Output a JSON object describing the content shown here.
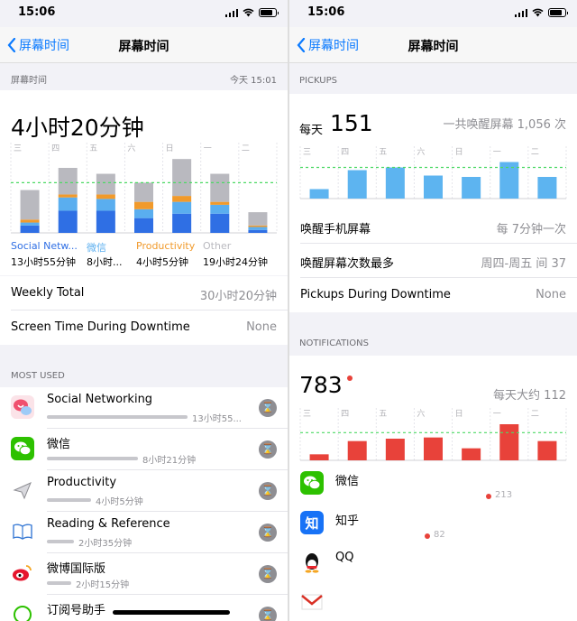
{
  "status": {
    "time": "15:06"
  },
  "nav": {
    "back_label": "屏幕时间",
    "title": "屏幕时间"
  },
  "left": {
    "section_label": "屏幕时间",
    "section_time": "今天 15:01",
    "total": "4小时20分钟",
    "day_labels": [
      "三",
      "四",
      "五",
      "六",
      "日",
      "一",
      "二"
    ],
    "legend": [
      {
        "name": "Social Netw...",
        "color": "#2f6fe4",
        "value": "13小时55分钟"
      },
      {
        "name": "微信",
        "color": "#5aaeef",
        "value": "8小时..."
      },
      {
        "name": "Productivity",
        "color": "#f19a2b",
        "value": "4小时5分钟"
      },
      {
        "name": "Other",
        "color": "#b9b9bf",
        "value": "19小时24分钟"
      }
    ],
    "weekly_total_label": "Weekly Total",
    "weekly_total_value": "30小时20分钟",
    "downtime_label": "Screen Time During Downtime",
    "downtime_value": "None",
    "most_used_label": "MOST USED",
    "apps": [
      {
        "name": "Social Networking",
        "time": "13小时55...",
        "icon": "social-networking-icon",
        "color": "#fbe3e8",
        "bar": 0.93
      },
      {
        "name": "微信",
        "time": "8小时21分钟",
        "icon": "wechat-icon",
        "color": "#2dc100",
        "bar": 0.6
      },
      {
        "name": "Productivity",
        "time": "4小时5分钟",
        "icon": "paper-plane-icon",
        "color": "#ffffff",
        "bar": 0.29
      },
      {
        "name": "Reading & Reference",
        "time": "2小时35分钟",
        "icon": "book-icon",
        "color": "#ffffff",
        "bar": 0.18
      },
      {
        "name": "微博国际版",
        "time": "2小时15分钟",
        "icon": "weibo-icon",
        "color": "#ffffff",
        "bar": 0.16
      },
      {
        "name": "订阅号助手",
        "time": "",
        "icon": "subscription-icon",
        "color": "#ffffff",
        "bar": 0
      }
    ]
  },
  "right": {
    "pickups_label": "PICKUPS",
    "pickups_prefix": "每天",
    "pickups_value": "151",
    "pickups_total": "一共唤醒屏幕 1,056 次",
    "day_labels": [
      "三",
      "四",
      "五",
      "六",
      "日",
      "一",
      "二"
    ],
    "wake_label": "唤醒手机屏幕",
    "wake_value": "每 7分钟一次",
    "most_label": "唤醒屏幕次数最多",
    "most_value": "周四-周五 间 37",
    "downtime_label": "Pickups During Downtime",
    "downtime_value": "None",
    "notifications_label": "NOTIFICATIONS",
    "notifications_value": "783",
    "notifications_avg": "每天大约 112",
    "notif_apps": [
      {
        "name": "微信",
        "count": "213",
        "icon": "wechat-icon",
        "color": "#2dc100"
      },
      {
        "name": "知乎",
        "count": "82",
        "icon": "zhihu-icon",
        "color": "#1772f6"
      },
      {
        "name": "QQ",
        "count": "",
        "icon": "qq-icon",
        "color": "#ffffff"
      },
      {
        "name": "",
        "count": "",
        "icon": "gmail-icon",
        "color": "#ffffff"
      }
    ]
  },
  "chart_data": [
    {
      "type": "bar",
      "title": "",
      "categories": [
        "三",
        "四",
        "五",
        "六",
        "日",
        "一",
        "二"
      ],
      "series": [
        {
          "name": "Social Netw...",
          "values": [
            0.5,
            1.5,
            1.5,
            1.0,
            1.3,
            1.3,
            0.2
          ]
        },
        {
          "name": "微信",
          "values": [
            0.2,
            0.9,
            0.8,
            0.6,
            0.8,
            0.6,
            0.2
          ]
        },
        {
          "name": "Productivity",
          "values": [
            0.2,
            0.2,
            0.3,
            0.5,
            0.4,
            0.2,
            0.1
          ]
        },
        {
          "name": "Other",
          "values": [
            2.0,
            1.8,
            1.4,
            1.3,
            2.5,
            1.9,
            0.9
          ]
        }
      ],
      "ylim": [
        0,
        5.5
      ],
      "average": 3.4
    },
    {
      "type": "bar",
      "title": "",
      "categories": [
        "三",
        "四",
        "五",
        "六",
        "日",
        "一",
        "二"
      ],
      "values": [
        35,
        105,
        115,
        85,
        80,
        135,
        80
      ],
      "ylim": [
        0,
        160
      ],
      "average": 115
    },
    {
      "type": "bar",
      "title": "",
      "categories": [
        "三",
        "四",
        "五",
        "六",
        "日",
        "一",
        "二"
      ],
      "values": [
        25,
        80,
        90,
        95,
        50,
        150,
        80
      ],
      "ylim": [
        0,
        180
      ],
      "average": 115
    }
  ]
}
